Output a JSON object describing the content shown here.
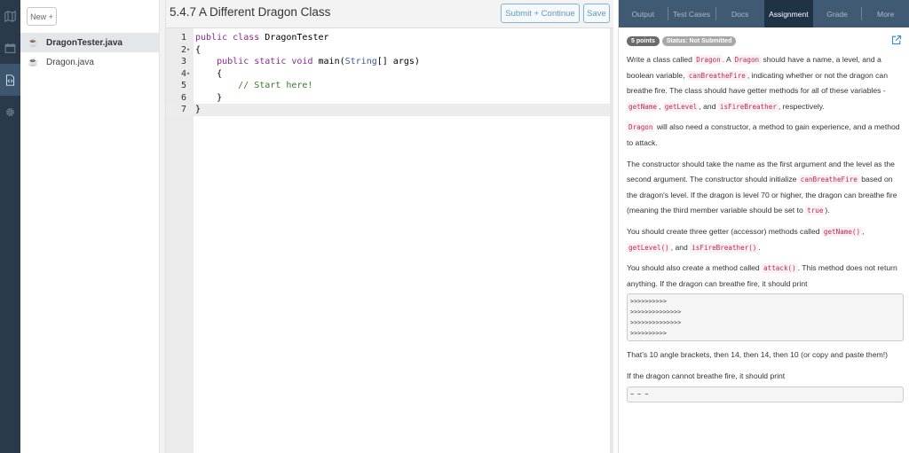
{
  "rail": {
    "items": [
      {
        "icon": "map-icon",
        "active": false
      },
      {
        "icon": "calendar-icon",
        "active": false
      },
      {
        "icon": "code-file-icon",
        "active": true
      },
      {
        "icon": "gear-icon",
        "active": false
      }
    ]
  },
  "files": {
    "new_label": "New +",
    "items": [
      {
        "name": "DragonTester.java",
        "active": true,
        "icon": "java-icon"
      },
      {
        "name": "Dragon.java",
        "active": false,
        "icon": "java-icon"
      }
    ]
  },
  "editor": {
    "title": "5.4.7 A Different Dragon Class",
    "submit_label": "Submit + Continue",
    "save_label": "Save",
    "active_line": 7,
    "lines": [
      {
        "n": "1",
        "fold": "",
        "text": "public class DragonTester"
      },
      {
        "n": "2",
        "fold": "-",
        "text": "{"
      },
      {
        "n": "3",
        "fold": "",
        "text": "    public static void main(String[] args)"
      },
      {
        "n": "4",
        "fold": "-",
        "text": "    {"
      },
      {
        "n": "5",
        "fold": "",
        "text": "        // Start here!"
      },
      {
        "n": "6",
        "fold": "",
        "text": "    }"
      },
      {
        "n": "7",
        "fold": "",
        "text": "}"
      }
    ]
  },
  "panel": {
    "tabs": [
      "Output",
      "Test Cases",
      "Docs",
      "Assignment",
      "Grade",
      "More"
    ],
    "active_tab": "Assignment",
    "points_badge": "5 points",
    "status_badge": "Status: Not Submitted",
    "p1": {
      "a": "Write a class called ",
      "c1": "Dragon",
      "b": ". A ",
      "c2": "Dragon",
      "c": " should have a name, a level, and a boolean variable, ",
      "c3": "canBreatheFire",
      "d": ", indicating whether or not the dragon can breathe fire. The class should have getter methods for all of these variables - ",
      "c4": "getName",
      "e": ", ",
      "c5": "getLevel",
      "f": ", and ",
      "c6": "isFireBreather",
      "g": ", respectively."
    },
    "p2": {
      "c1": "Dragon",
      "a": " will also need a constructor, a method to gain experience, and a method to attack."
    },
    "p3": {
      "a": "The constructor should take the name as the first argument and the level as the second argument. The constructor should initialize ",
      "c1": "canBreatheFire",
      "b": " based on the dragon's level. If the dragon is level 70 or higher, the dragon can breathe fire (meaning the third member variable should be set to ",
      "c2": "true",
      "c": ")."
    },
    "p4": {
      "a": "You should create three getter (accessor) methods called ",
      "c1": "getName()",
      "b": ", ",
      "c2": "getLevel()",
      "c": ", and ",
      "c3": "isFireBreather()",
      "d": "."
    },
    "p5": {
      "a": "You should also create a method called ",
      "c1": "attack()",
      "b": ". This method does not return anything. If the dragon can breathe fire, it should print"
    },
    "fire_output": ">>>>>>>>>>\n>>>>>>>>>>>>>>\n>>>>>>>>>>>>>>\n>>>>>>>>>>",
    "p6": "That's 10 angle brackets, then 14, then 14, then 10 (or copy and paste them!)",
    "p7": "If the dragon cannot breathe fire, it should print",
    "nofire_output": "~ ~ ~"
  },
  "colors": {
    "rail_bg": "#2b3a4a",
    "tab_bar": "#415a73",
    "tab_active": "#1f3346",
    "button_border": "#7fb4d6",
    "inline_code": "#c7254e"
  }
}
